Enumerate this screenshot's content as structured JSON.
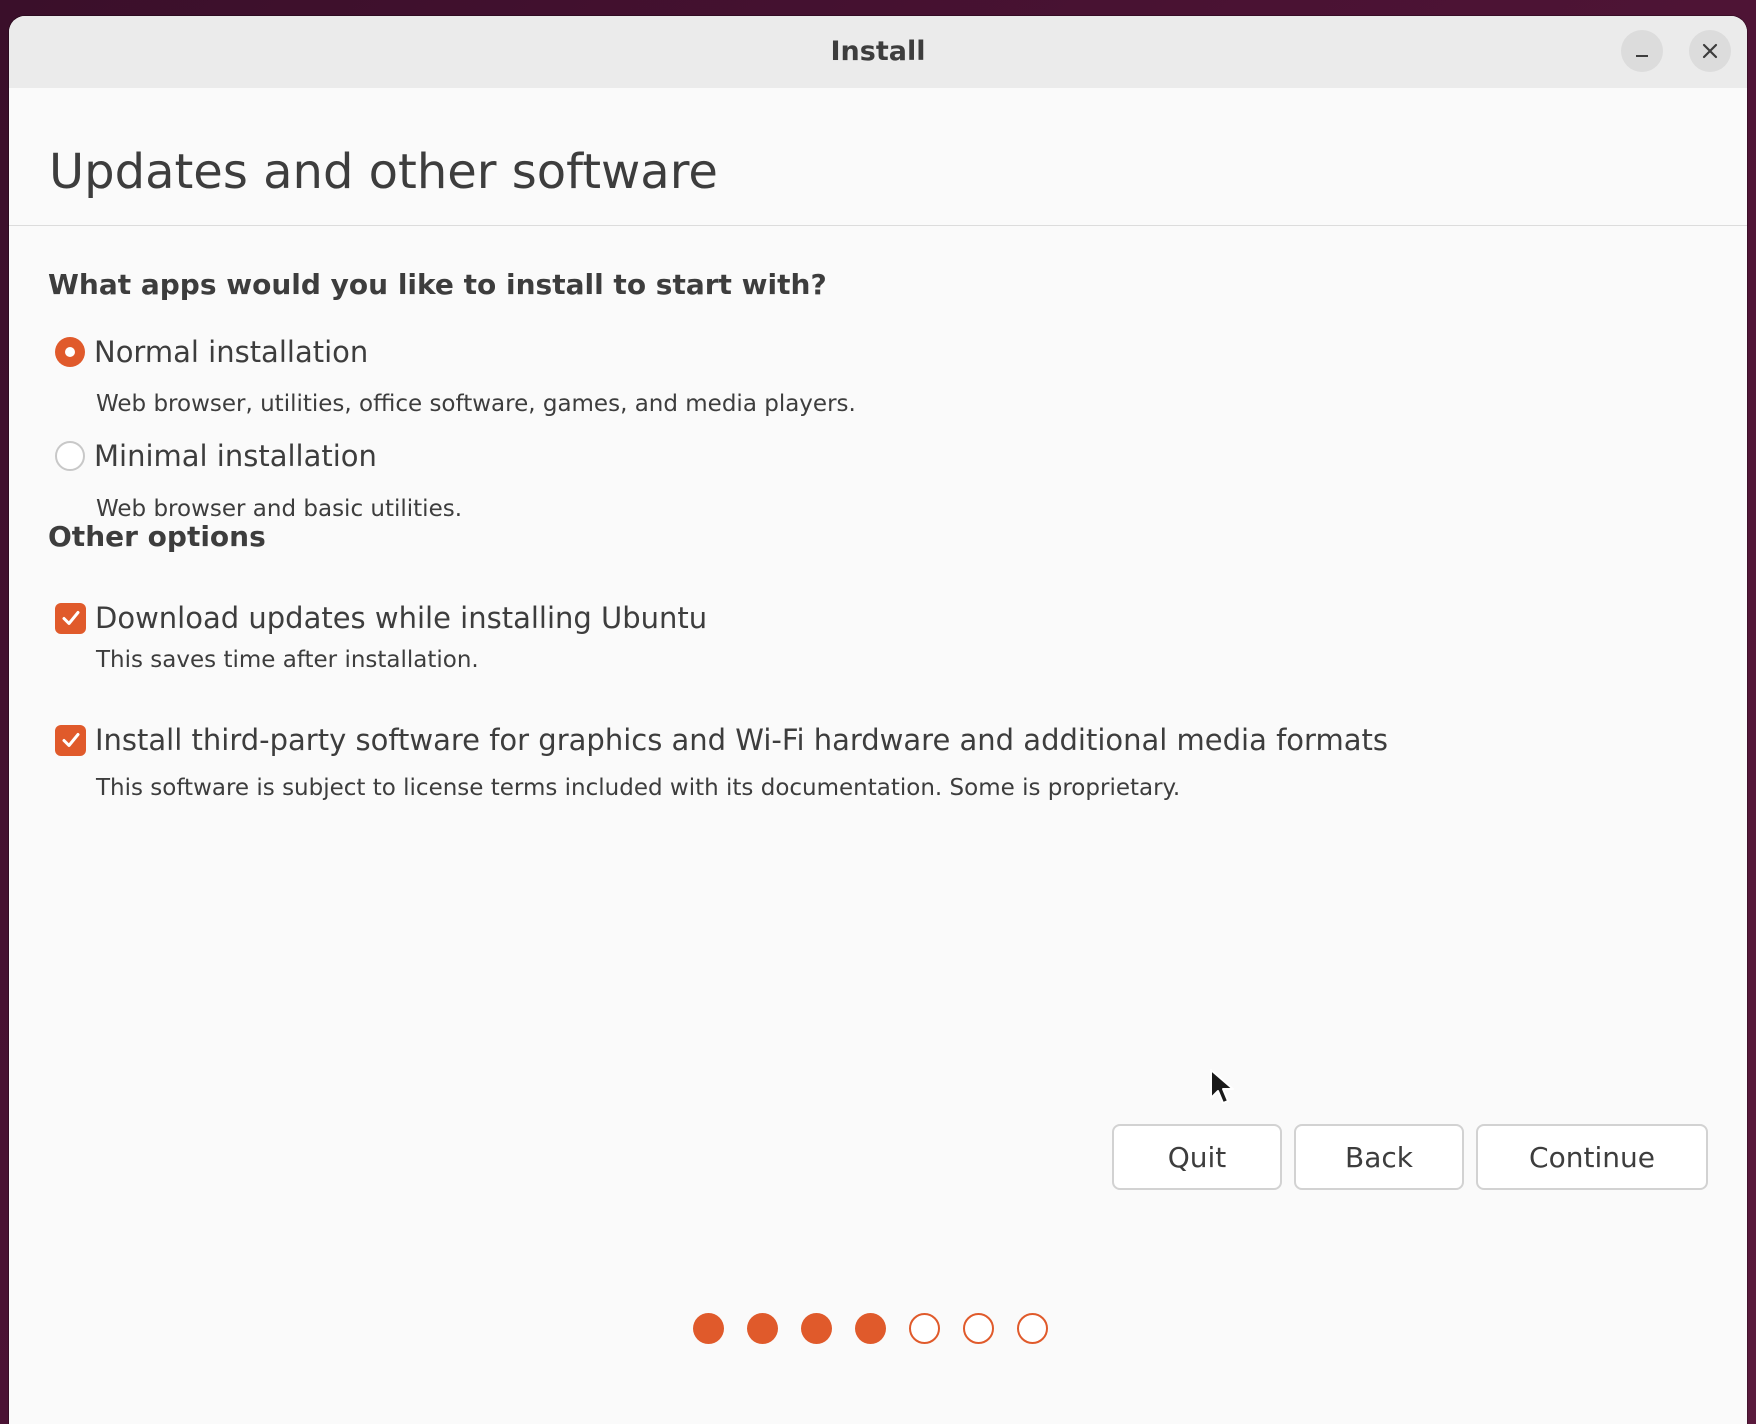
{
  "window": {
    "title": "Install"
  },
  "page": {
    "title": "Updates and other software"
  },
  "install_type": {
    "question": "What apps would you like to install to start with?",
    "options": [
      {
        "label": "Normal installation",
        "description": "Web browser, utilities, office software, games, and media players.",
        "selected": true
      },
      {
        "label": "Minimal installation",
        "description": "Web browser and basic utilities.",
        "selected": false
      }
    ]
  },
  "other_options": {
    "heading": "Other options",
    "items": [
      {
        "label": "Download updates while installing Ubuntu",
        "description": "This saves time after installation.",
        "checked": true
      },
      {
        "label": "Install third-party software for graphics and Wi-Fi hardware and additional media formats",
        "description": "This software is subject to license terms included with its documentation. Some is proprietary.",
        "checked": true
      }
    ]
  },
  "buttons": {
    "quit": "Quit",
    "back": "Back",
    "continue": "Continue"
  },
  "progress": {
    "total_steps": 7,
    "completed_steps": 4
  },
  "icons": {
    "minimize": "minimize-icon",
    "close": "close-icon",
    "checkmark": "checkmark-icon",
    "cursor": "mouse-pointer-icon"
  },
  "colors": {
    "accent": "#e05a2b",
    "background": "#fafafa",
    "titlebar": "#ebebeb",
    "text": "#3d3d3d"
  }
}
